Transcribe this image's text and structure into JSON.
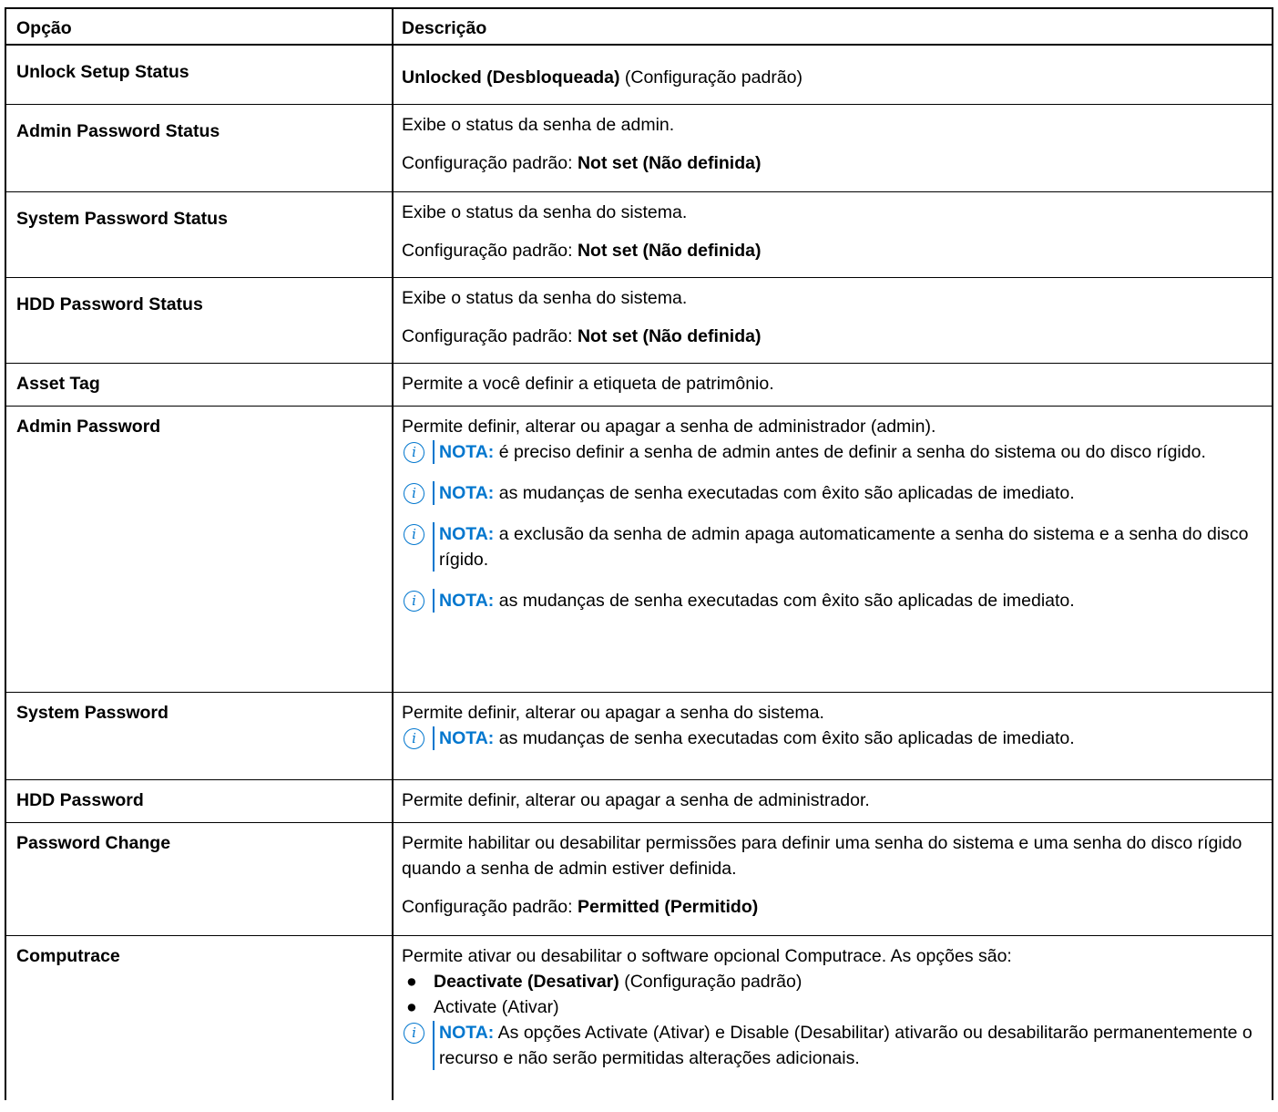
{
  "table": {
    "header": {
      "col1": "Opção",
      "col2": "Descrição"
    },
    "note_label": "NOTA:",
    "default_prefix": "Configuração padrão:",
    "rows": {
      "unlock_setup_status": {
        "option": "Unlock Setup Status",
        "value_bold": "Unlocked (Desbloqueada)",
        "value_suffix": " (Configuração padrão)"
      },
      "admin_password_status": {
        "option": "Admin Password Status",
        "desc": "Exibe o status da senha de admin.",
        "default": "Not set (Não definida)"
      },
      "system_password_status": {
        "option": "System Password Status",
        "desc": "Exibe o status da senha do sistema.",
        "default": "Not set (Não definida)"
      },
      "hdd_password_status": {
        "option": "HDD Password Status",
        "desc": "Exibe o status da senha do sistema.",
        "default": "Not set (Não definida)"
      },
      "asset_tag": {
        "option": "Asset Tag",
        "desc": "Permite a você definir a etiqueta de patrimônio."
      },
      "admin_password": {
        "option": "Admin Password",
        "desc": "Permite definir, alterar ou apagar a senha de administrador (admin).",
        "notes": [
          "é preciso definir a senha de admin antes de definir a senha do sistema ou do disco rígido.",
          "as mudanças de senha executadas com êxito são aplicadas de imediato.",
          "a exclusão da senha de admin apaga automaticamente a senha do sistema e a senha do disco rígido.",
          "as mudanças de senha executadas com êxito são aplicadas de imediato."
        ]
      },
      "system_password": {
        "option": "System Password",
        "desc": "Permite definir, alterar ou apagar a senha do sistema.",
        "note": "as mudanças de senha executadas com êxito são aplicadas de imediato."
      },
      "hdd_password": {
        "option": "HDD Password",
        "desc": "Permite definir, alterar ou apagar a senha de administrador."
      },
      "password_change": {
        "option": "Password Change",
        "desc": "Permite habilitar ou desabilitar permissões para definir uma senha do sistema e uma senha do disco rígido quando a senha de admin estiver definida.",
        "default": "Permitted (Permitido)"
      },
      "computrace": {
        "option": "Computrace",
        "desc": "Permite ativar ou desabilitar o software opcional Computrace. As opções são:",
        "options": [
          {
            "bold": "Deactivate (Desativar)",
            "suffix": " (Configuração padrão)"
          },
          {
            "bold": "",
            "suffix": "Activate (Ativar)"
          }
        ],
        "note": "As opções Activate (Ativar) e Disable (Desabilitar) ativarão ou desabilitarão permanentemente o recurso e não serão permitidas alterações adicionais."
      }
    }
  }
}
